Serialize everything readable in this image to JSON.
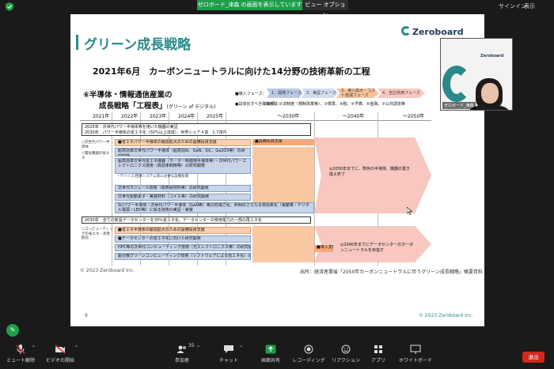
{
  "topbar": {
    "share_banner": "ゼロボード_津森 の画面を表示しています",
    "view_options": "ビュー オプション",
    "signin": "サインイン",
    "view_label": "表示",
    "icon": "shield-check-icon"
  },
  "slide": {
    "title": "グリーン成長戦略",
    "logo_text": "Zeroboard",
    "subtitle": "2021年6月　カーボンニュートラルに向けた14分野の技術革新の工程",
    "section_title_line1": "⑥半導体・情報通信産業の",
    "section_title_line2": "成長戦略「工程表」",
    "section_title_sub": "(グリーン of デジタル)",
    "phase_label": "■導入フェーズ：",
    "phases": [
      "1．開発フェーズ",
      "2．実証フェーズ",
      "3．導入拡大・コスト低減フェーズ",
      "4．自立商用フェーズ"
    ],
    "policy_label": "●具体化すべき政策手法：",
    "policy_text": "①目標、②法制度（規制改革等）、③標準、④税、⑤予算、⑥金融、⑦公共調達等",
    "years": [
      "2021年",
      "2022年",
      "2023年",
      "2024年",
      "2025年",
      "〜2030年",
      "〜2040年",
      "〜2050年"
    ],
    "goal_2025": "2025年　次世代パワー半導体等を用いた機器の実証",
    "goal_2030_a": "2030年　パワー半導体の省エネ化（50%以上達成）、世界シェア４割　1.7兆円",
    "side_label_a1": "○次世代パワー半導体",
    "side_label_a2": "○電気機器の省エネ",
    "bars_a": [
      "■省エネパワー半導体の製造拡大のための設備投資支援",
      "超高効率次世代パワー半導体（超高効Si、GaN、SiC、Ga2O3等）の研究開発",
      "超高効率次世代省エネ機器（モーター制御用半導体等）・次世代パワーエレクトロニクス技術（高効率制御等）の研究開発",
      "次世代モジュール技術（高熱耐材料等）の研究開発",
      "次世代受動素子・実装材料（コイル等）の研究開発",
      "Si/パワー半導体・次世代パワー半導体（GaN等）等の低電力化、照明のさらなる高効率化（電動車・デジタル電源・LED等）に係る技術の実証・実装"
    ],
    "bar_a_sub": "・デバイス/回路システム等に必要な設備投資",
    "orange_a": "■設備投資支援",
    "big_arrow_a": "◎2050年までに、既存の半導体、機器の置き換え終了",
    "goal_2030_b": "2030年　全ての新設データセンターを30%省エネ化、データセンターの使用電力の一部の再エネ化",
    "side_label_b1": "○コンピューティングの省エネ・高性能化",
    "bars_b": [
      "■省エネ半導体の製造拡大のための設備投資支援",
      "■データセンターの省エネ化に向けた研究開発",
      "HPC等の次世代コンピューティング技術（光エレクトロニクス等）の研究開発",
      "超分散グリーンコンピューティング技術（ソフトウェアによる省エネ化）の研究開発"
    ],
    "orange_b": "■導入支援",
    "big_arrow_b": "◎2040年までにデータセンターのカーボンニュートラルを目指す",
    "copyright": "© 2023 Zeroboard Inc.",
    "source": "出所：経済産業省「2050年カーボンニュートラルに伴うグリーン成長戦略」概要資料",
    "page_number": "9",
    "footer_copyright": "© 2023 Zeroboard Inc."
  },
  "video": {
    "logo_text": "Zeroboard",
    "name_tag": "ゼロボード_津森"
  },
  "toolbar": {
    "mute": "ミュート解除",
    "video": "ビデオの開始",
    "participants": "参加者",
    "participants_count": "35",
    "chat": "チャット",
    "share_screen": "画面共有",
    "record": "レコーディング",
    "reactions": "リアクション",
    "apps": "アプリ",
    "whiteboard": "ホワイトボード",
    "end": "退出"
  },
  "colors": {
    "accent": "#2a8a8a",
    "share_green": "#1f9e4a",
    "end_red": "#d4281c",
    "bar_blue": "#c9d4e8",
    "bar_orange": "#f5a97a",
    "arrow_pink": "#f7c7c0"
  }
}
